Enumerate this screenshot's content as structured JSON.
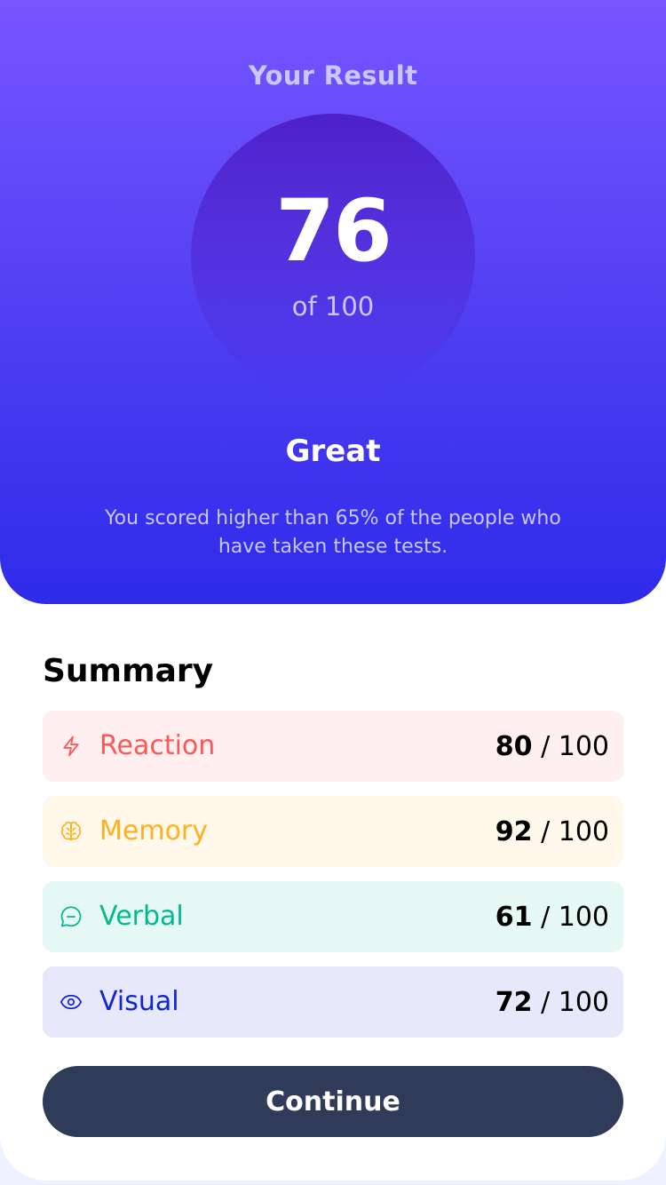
{
  "result": {
    "title": "Your Result",
    "score": "76",
    "of_label": "of 100",
    "rating": "Great",
    "description": "You scored higher than 65% of the people who have taken these tests."
  },
  "summary": {
    "title": "Summary",
    "items": [
      {
        "label": "Reaction",
        "score": "80",
        "total": "/ 100",
        "icon": "lightning-icon",
        "color": "#ff5757",
        "bg": "#fff0ef"
      },
      {
        "label": "Memory",
        "score": "92",
        "total": "/ 100",
        "icon": "brain-icon",
        "color": "#ffb01f",
        "bg": "#fff8eb"
      },
      {
        "label": "Verbal",
        "score": "61",
        "total": "/ 100",
        "icon": "chat-bubble-icon",
        "color": "#00bb8f",
        "bg": "#e5f8f4"
      },
      {
        "label": "Visual",
        "score": "72",
        "total": "/ 100",
        "icon": "eye-icon",
        "color": "#1125d4",
        "bg": "#e7e9fb"
      }
    ]
  },
  "actions": {
    "continue_label": "Continue"
  },
  "colors": {
    "gradient_top": "#7755ff",
    "gradient_bottom": "#2e2be9",
    "button": "#303b5a"
  }
}
